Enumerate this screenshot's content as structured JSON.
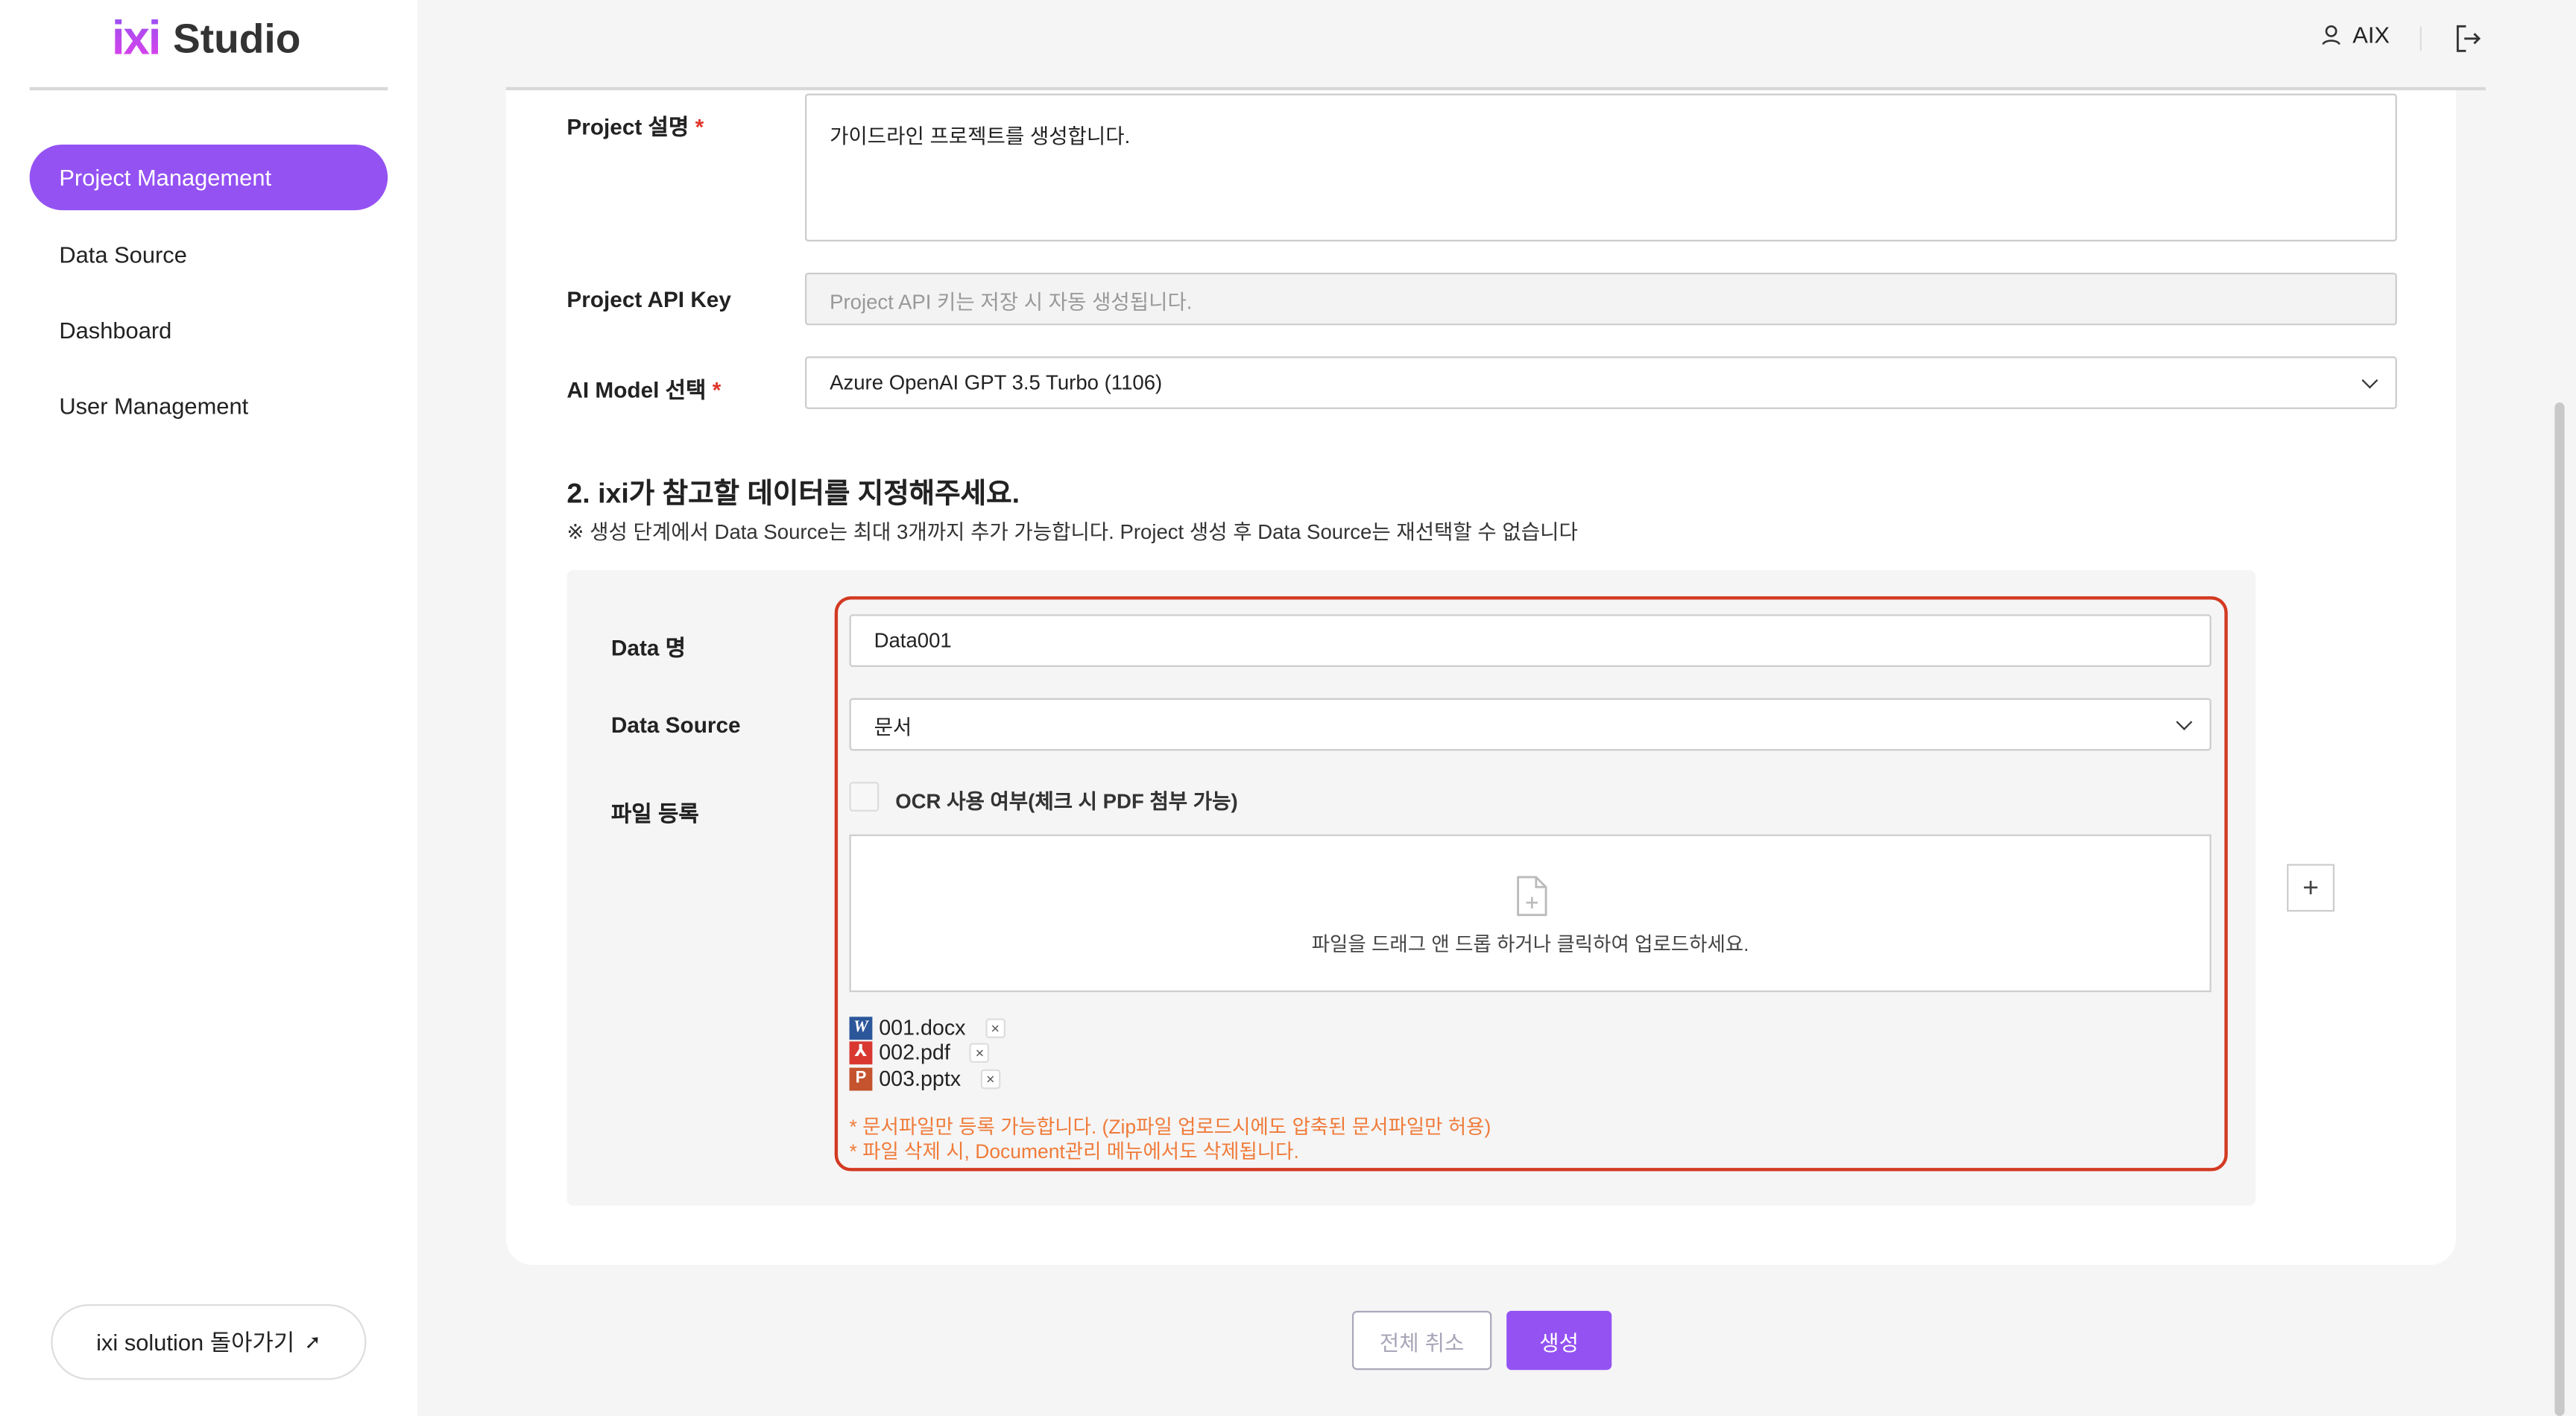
{
  "logo": {
    "mark": "ixi",
    "text": "Studio"
  },
  "sidebar": {
    "items": [
      {
        "label": "Project Management",
        "active": true
      },
      {
        "label": "Data Source"
      },
      {
        "label": "Dashboard"
      },
      {
        "label": "User Management"
      }
    ],
    "back_label": "ixi solution 돌아가기"
  },
  "header": {
    "user": "AIX"
  },
  "form": {
    "desc_label": "Project 설명",
    "desc_value": "가이드라인 프로젝트를 생성합니다.",
    "api_label": "Project API Key",
    "api_placeholder": "Project API 키는 저장 시 자동 생성됩니다.",
    "model_label": "AI Model 선택",
    "model_value": "Azure OpenAI GPT 3.5 Turbo (1106)",
    "required_mark": "*"
  },
  "section2": {
    "title": "2. ixi가 참고할 데이터를 지정해주세요.",
    "note": "※ 생성 단계에서 Data Source는 최대 3개까지 추가 가능합니다. Project 생성 후 Data Source는 재선택할 수 없습니다",
    "data_name_label": "Data 명",
    "data_name_value": "Data001",
    "source_label": "Data Source",
    "source_value": "문서",
    "file_label": "파일 등록",
    "ocr_label": "OCR 사용 여부(체크 시 PDF 첨부 가능)",
    "ocr_checked": false,
    "drop_text": "파일을 드래그 앤 드롭 하거나 클릭하여 업로드하세요.",
    "files": [
      {
        "name": "001.docx",
        "type": "W",
        "color": "#2b579a"
      },
      {
        "name": "002.pdf",
        "type": "A",
        "color": "#d93831"
      },
      {
        "name": "003.pptx",
        "type": "P",
        "color": "#c4532e"
      }
    ],
    "remove": "×",
    "notes": [
      "* 문서파일만 등록 가능합니다. (Zip파일 업로드시에도 압축된 문서파일만 허용)",
      "* 파일 삭제 시, Document관리 메뉴에서도 삭제됩니다."
    ],
    "add": "+"
  },
  "actions": {
    "cancel": "전체 취소",
    "create": "생성"
  },
  "colors": {
    "accent": "#9452f3",
    "highlight": "#d33a22",
    "note": "#f07b3a"
  }
}
